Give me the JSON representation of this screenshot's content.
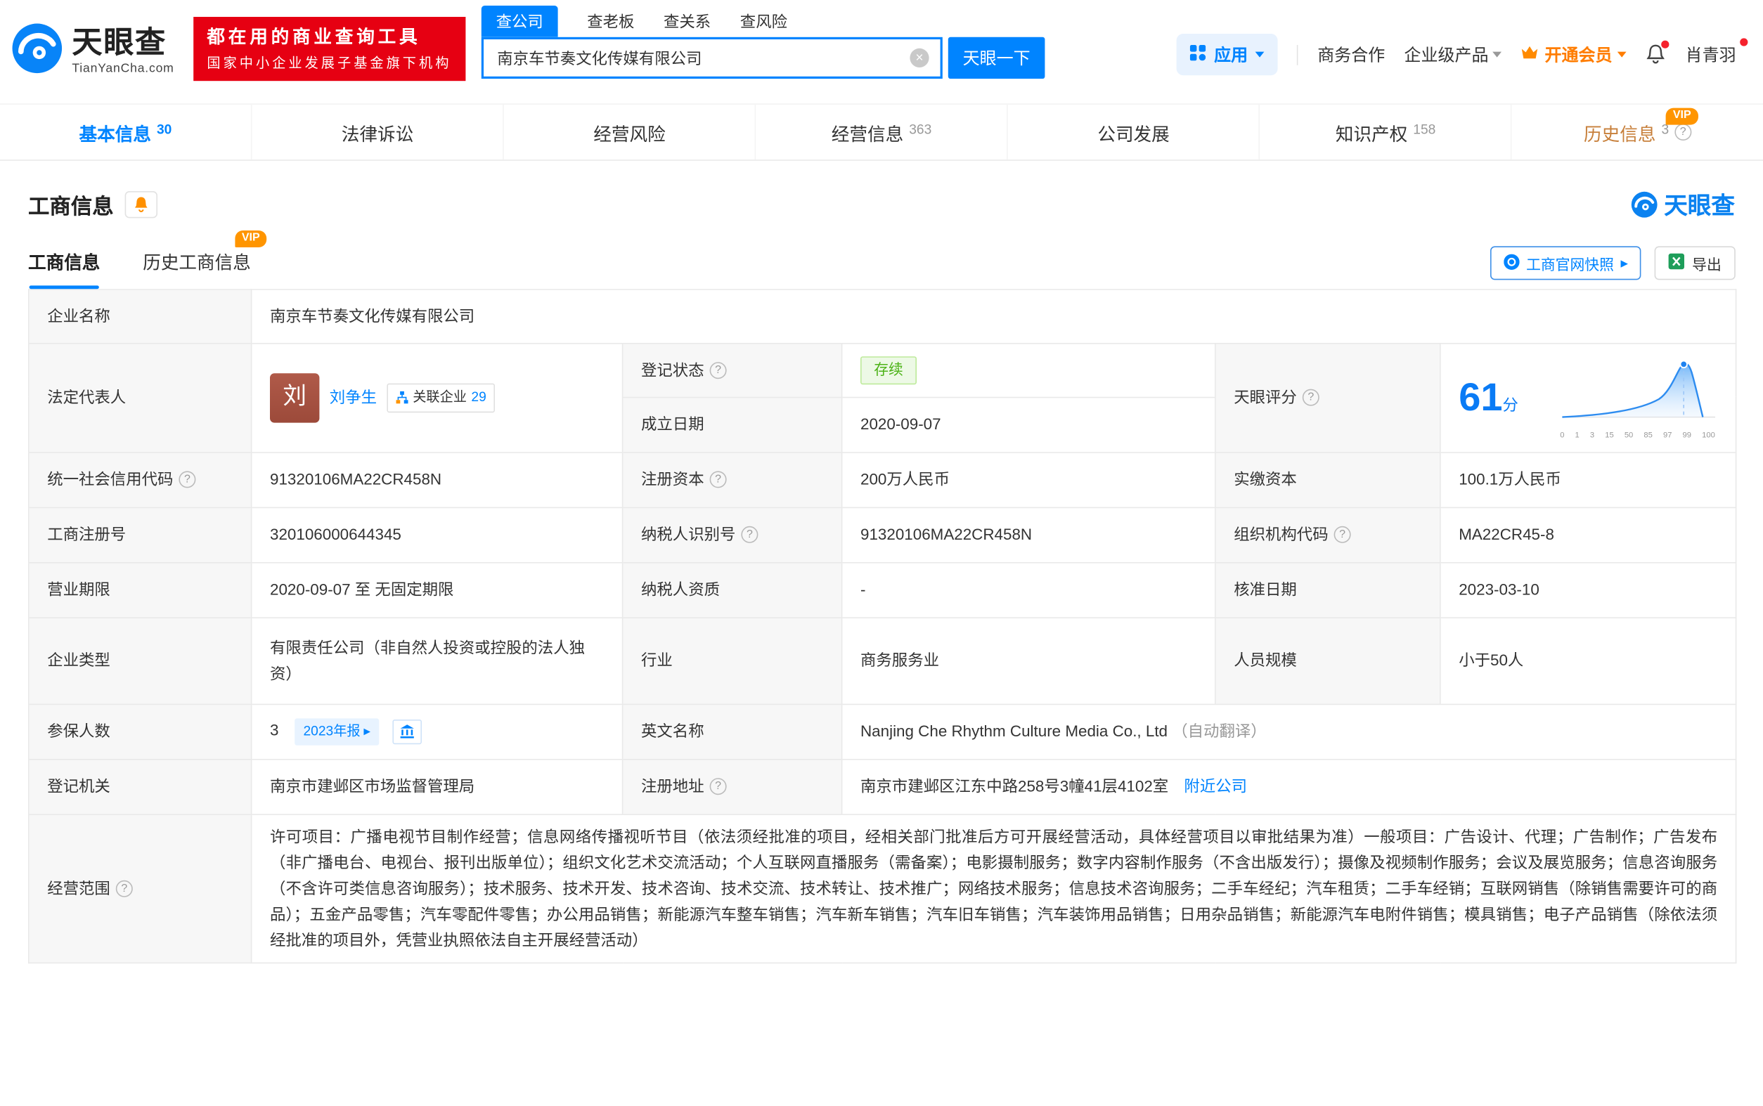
{
  "brand": {
    "name": "天眼查",
    "domain": "TianYanCha.com"
  },
  "promo": {
    "line1": "都在用的商业查询工具",
    "line2": "国家中小企业发展子基金旗下机构"
  },
  "search": {
    "tabs": [
      {
        "label": "查公司"
      },
      {
        "label": "查老板"
      },
      {
        "label": "查关系"
      },
      {
        "label": "查风险"
      }
    ],
    "value": "南京车节奏文化传媒有限公司",
    "submit": "天眼一下"
  },
  "topnav": {
    "apps": "应用",
    "cooperation": "商务合作",
    "enterprise": "企业级产品",
    "vip": "开通会员",
    "username": "肖青羽"
  },
  "nav_tabs": [
    {
      "label": "基本信息",
      "count": "30"
    },
    {
      "label": "法律诉讼",
      "count": ""
    },
    {
      "label": "经营风险",
      "count": ""
    },
    {
      "label": "经营信息",
      "count": "363"
    },
    {
      "label": "公司发展",
      "count": ""
    },
    {
      "label": "知识产权",
      "count": "158"
    },
    {
      "label": "历史信息",
      "count": "3"
    }
  ],
  "section": {
    "title": "工商信息",
    "brand": "天眼查",
    "subtab_active": "工商信息",
    "subtab_history": "历史工商信息",
    "vip_tag": "VIP",
    "snapshot_btn": "工商官网快照",
    "export_btn": "导出"
  },
  "fields": {
    "company_name_label": "企业名称",
    "company_name": "南京车节奏文化传媒有限公司",
    "legal_rep_label": "法定代表人",
    "legal_rep_avatar": "刘",
    "legal_rep_name": "刘争生",
    "related_label": "关联企业",
    "related_count": "29",
    "reg_status_label": "登记状态",
    "reg_status": "存续",
    "establish_label": "成立日期",
    "establish_date": "2020-09-07",
    "score_label": "天眼评分",
    "score_value": "61",
    "score_unit": "分",
    "credit_code_label": "统一社会信用代码",
    "credit_code": "91320106MA22CR458N",
    "reg_capital_label": "注册资本",
    "reg_capital": "200万人民币",
    "paid_capital_label": "实缴资本",
    "paid_capital": "100.1万人民币",
    "reg_number_label": "工商注册号",
    "reg_number": "320106000644345",
    "taxpayer_id_label": "纳税人识别号",
    "taxpayer_id": "91320106MA22CR458N",
    "org_code_label": "组织机构代码",
    "org_code": "MA22CR45-8",
    "biz_term_label": "营业期限",
    "biz_term": "2020-09-07 至 无固定期限",
    "taxpayer_quality_label": "纳税人资质",
    "taxpayer_quality": "-",
    "approval_date_label": "核准日期",
    "approval_date": "2023-03-10",
    "company_type_label": "企业类型",
    "company_type": "有限责任公司（非自然人投资或控股的法人独资）",
    "industry_label": "行业",
    "industry": "商务服务业",
    "staff_size_label": "人员规模",
    "staff_size": "小于50人",
    "insured_label": "参保人数",
    "insured_count": "3",
    "annual_report_badge": "2023年报",
    "english_name_label": "英文名称",
    "english_name": "Nanjing Che Rhythm Culture Media Co., Ltd",
    "english_name_note": "（自动翻译）",
    "registry_label": "登记机关",
    "registry": "南京市建邺区市场监督管理局",
    "address_label": "注册地址",
    "address": "南京市建邺区江东中路258号3幢41层4102室",
    "nearby_link": "附近公司",
    "scope_label": "经营范围",
    "scope": "许可项目：广播电视节目制作经营；信息网络传播视听节目（依法须经批准的项目，经相关部门批准后方可开展经营活动，具体经营项目以审批结果为准）一般项目：广告设计、代理；广告制作；广告发布（非广播电台、电视台、报刊出版单位）；组织文化艺术交流活动；个人互联网直播服务（需备案）；电影摄制服务；数字内容制作服务（不含出版发行）；摄像及视频制作服务；会议及展览服务；信息咨询服务（不含许可类信息咨询服务）；技术服务、技术开发、技术咨询、技术交流、技术转让、技术推广；网络技术服务；信息技术咨询服务；二手车经纪；汽车租赁；二手车经销；互联网销售（除销售需要许可的商品）；五金产品零售；汽车零配件零售；办公用品销售；新能源汽车整车销售；汽车新车销售；汽车旧车销售；汽车装饰用品销售；日用杂品销售；新能源汽车电附件销售；模具销售；电子产品销售（除依法须经批准的项目外，凭营业执照依法自主开展经营活动）"
  },
  "score_chart": {
    "type": "line",
    "score": 61,
    "x_ticks": [
      "0",
      "1",
      "3",
      "15",
      "50",
      "85",
      "97",
      "99",
      "100"
    ]
  },
  "colors": {
    "primary": "#0084ff",
    "vip_orange": "#ff9500",
    "promo_red": "#e60012",
    "status_green": "#4db318"
  }
}
